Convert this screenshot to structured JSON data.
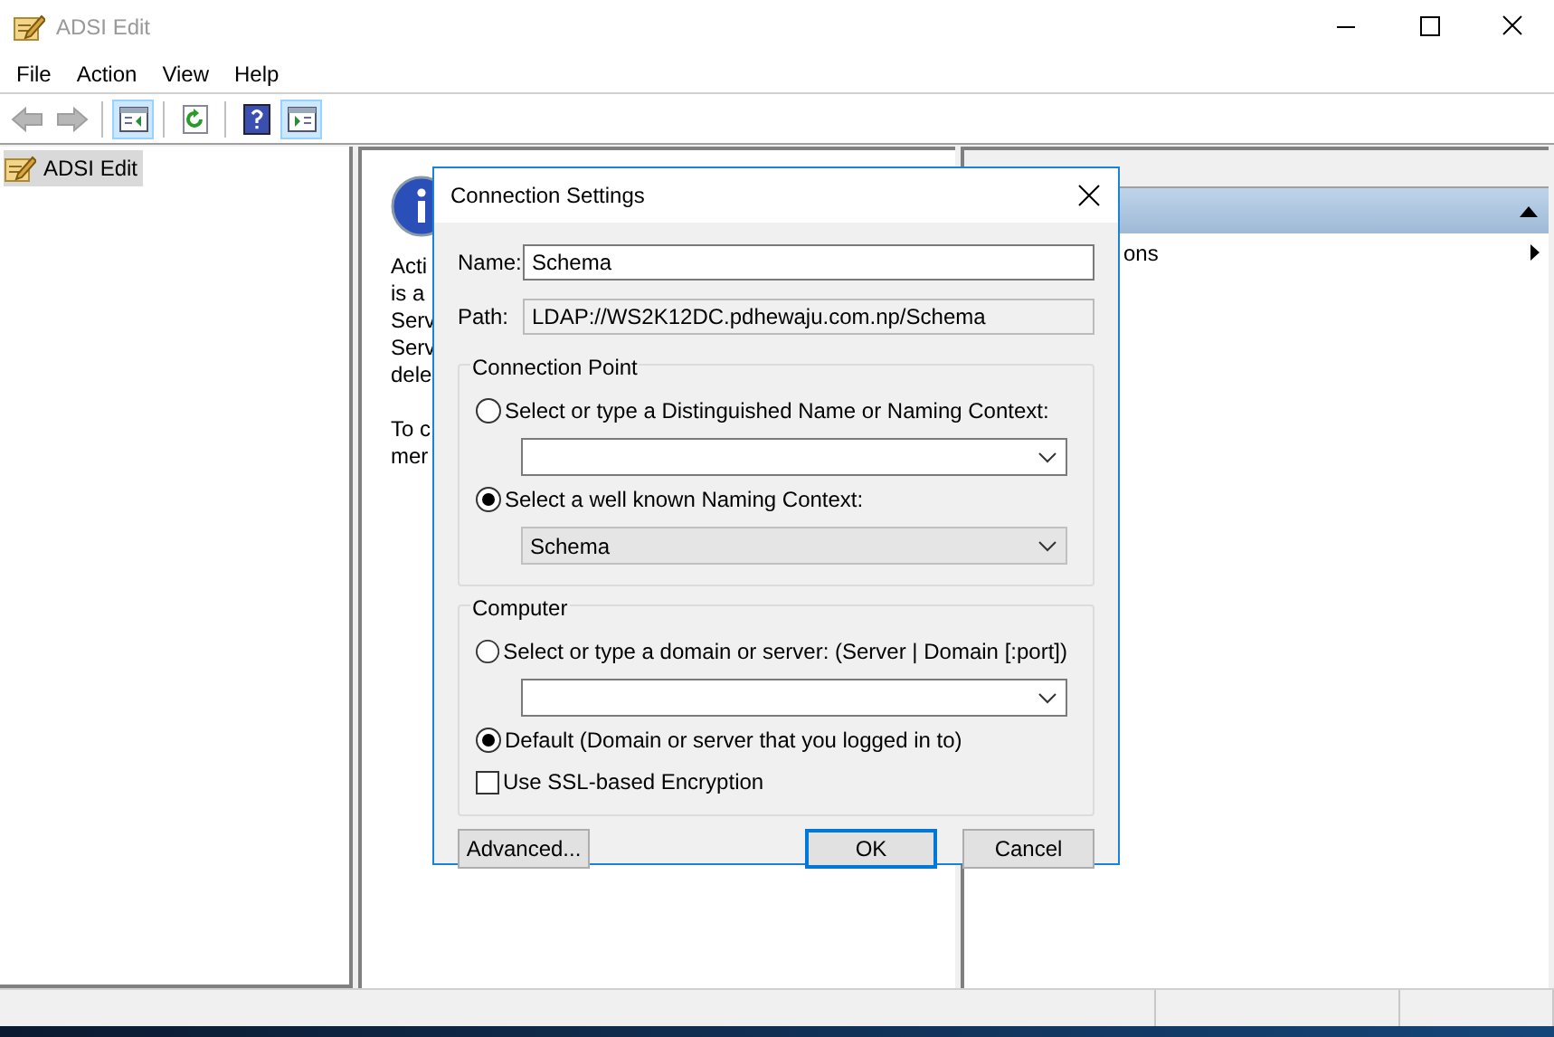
{
  "window": {
    "title": "ADSI Edit"
  },
  "menu": [
    "File",
    "Action",
    "View",
    "Help"
  ],
  "toolbar": [
    {
      "kind": "back",
      "disabled": true,
      "selected": false
    },
    {
      "kind": "forward",
      "disabled": true,
      "selected": false
    },
    {
      "kind": "tree",
      "disabled": false,
      "selected": true
    },
    {
      "kind": "refresh",
      "disabled": false,
      "selected": false
    },
    {
      "kind": "help",
      "disabled": false,
      "selected": false
    },
    {
      "kind": "action-pane",
      "disabled": false,
      "selected": true
    }
  ],
  "tree": {
    "items": [
      {
        "label": "ADSI Edit",
        "selected": true
      }
    ]
  },
  "center_pane": {
    "paragraphs": [
      [
        "Acti",
        "is a",
        "Serv",
        "Serv",
        "dele"
      ],
      [
        "To c",
        "mer"
      ]
    ]
  },
  "actions_pane": {
    "items": [
      {
        "label": "ons",
        "kind": "submenu"
      }
    ]
  },
  "dialog": {
    "title": "Connection Settings",
    "name": {
      "label": "Name:",
      "value": "Schema"
    },
    "path": {
      "label": "Path:",
      "value": "LDAP://WS2K12DC.pdhewaju.com.np/Schema",
      "disabled": true
    },
    "groups": [
      {
        "title": "Connection Point",
        "options": [
          {
            "kind": "radio",
            "label": "Select or type a Distinguished Name or Naming Context:",
            "selected": false,
            "combo": {
              "disabled": false
            }
          },
          {
            "kind": "radio",
            "label": "Select a well known Naming Context:",
            "selected": true,
            "combo": {
              "value": "Schema",
              "disabled": true
            }
          }
        ]
      },
      {
        "title": "Computer",
        "options": [
          {
            "kind": "radio",
            "label": "Select or type a domain or server: (Server | Domain [:port])",
            "selected": false,
            "combo": {
              "disabled": false
            }
          },
          {
            "kind": "radio",
            "label": "Default (Domain or server that you logged in to)",
            "selected": true
          },
          {
            "kind": "checkbox",
            "label": "Use SSL-based Encryption",
            "checked": false
          }
        ]
      }
    ],
    "buttons": [
      {
        "label": "Advanced...",
        "default": false
      },
      {
        "label": "OK",
        "default": true
      },
      {
        "label": "Cancel",
        "default": false
      }
    ]
  }
}
